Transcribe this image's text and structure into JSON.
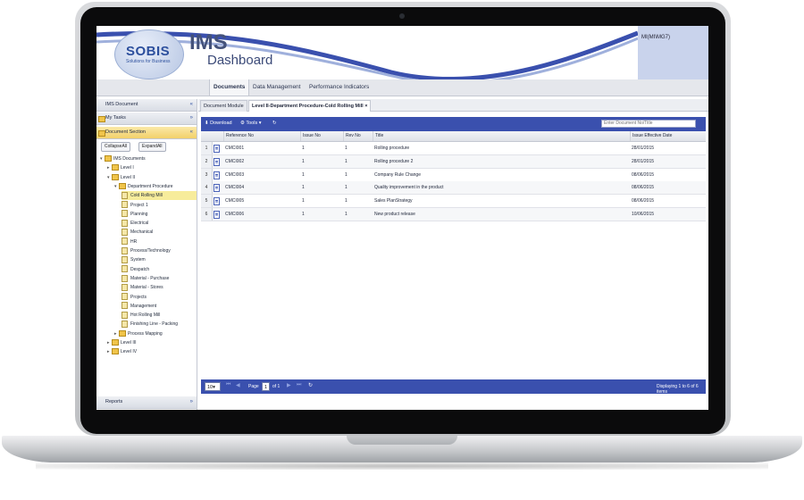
{
  "header": {
    "logo_text": "SOBIS",
    "logo_sub": "Solutions for Business",
    "title_main": "IMS",
    "title_sub": "Dashboard",
    "user_label": "MI(MI\\MG7)"
  },
  "tabs": [
    "Documents",
    "Data Management",
    "Performance Indicators"
  ],
  "left_panel": {
    "sections": {
      "ims_document": "IMS Document",
      "my_tasks": "My Tasks",
      "document_section": "Document Section",
      "reports": "Reports"
    },
    "buttons": {
      "collapse": "CollapseAll",
      "expand": "ExpandAll"
    },
    "tree": [
      {
        "label": "IMS Documents",
        "type": "folder",
        "toggle": "▾"
      },
      {
        "label": "Level I",
        "type": "folder",
        "toggle": "▸"
      },
      {
        "label": "Level II",
        "type": "folder",
        "toggle": "▾"
      },
      {
        "label": "Department Procedure",
        "type": "folder",
        "toggle": "▾"
      },
      {
        "label": "Cold Rolling Mill",
        "type": "doc",
        "selected": true
      },
      {
        "label": "Project 1",
        "type": "doc"
      },
      {
        "label": "Planning",
        "type": "doc"
      },
      {
        "label": "Electrical",
        "type": "doc"
      },
      {
        "label": "Mechanical",
        "type": "doc"
      },
      {
        "label": "HR",
        "type": "doc"
      },
      {
        "label": "Process/Technology",
        "type": "doc"
      },
      {
        "label": "System",
        "type": "doc"
      },
      {
        "label": "Despatch",
        "type": "doc"
      },
      {
        "label": "Material - Purchase",
        "type": "doc"
      },
      {
        "label": "Material - Stores",
        "type": "doc"
      },
      {
        "label": "Projects",
        "type": "doc"
      },
      {
        "label": "Management",
        "type": "doc"
      },
      {
        "label": "Hot Rolling Mill",
        "type": "doc"
      },
      {
        "label": "Finishing Line - Packing",
        "type": "doc"
      },
      {
        "label": "Process Mapping",
        "type": "folder",
        "toggle": "▸"
      },
      {
        "label": "Level III",
        "type": "folder",
        "toggle": "▸"
      },
      {
        "label": "Level IV",
        "type": "folder",
        "toggle": "▸"
      }
    ]
  },
  "subtabs": [
    "Document Module",
    "Level II-Department Procedure-Cold Rolling Mill"
  ],
  "toolbar": {
    "download": "Download",
    "tools": "Tools",
    "search_placeholder": "Enter Document No/Title"
  },
  "grid": {
    "columns": [
      "Reference No",
      "Issue No",
      "Rev No",
      "Title",
      "Issue Effective Date"
    ],
    "rows": [
      {
        "n": "1",
        "ref": "CMCI001",
        "issue": "1",
        "rev": "1",
        "title": "Rolling procedure",
        "date": "28/01/2015"
      },
      {
        "n": "2",
        "ref": "CMCI002",
        "issue": "1",
        "rev": "1",
        "title": "Rolling procedure 2",
        "date": "28/01/2015"
      },
      {
        "n": "3",
        "ref": "CMCI003",
        "issue": "1",
        "rev": "1",
        "title": "Company Rule Change",
        "date": "08/06/2015"
      },
      {
        "n": "4",
        "ref": "CMCI004",
        "issue": "1",
        "rev": "1",
        "title": "Quality improvement in the product",
        "date": "08/06/2015"
      },
      {
        "n": "5",
        "ref": "CMCI005",
        "issue": "1",
        "rev": "1",
        "title": "Sales PlanStrategy",
        "date": "08/06/2015"
      },
      {
        "n": "6",
        "ref": "CMCI006",
        "issue": "1",
        "rev": "1",
        "title": "New product release",
        "date": "10/06/2015"
      }
    ]
  },
  "pager": {
    "page_size": "10",
    "page_label": "Page",
    "page_value": "1",
    "of_label": "of 1",
    "display_text": "Displaying 1 to 6 of 6 items"
  }
}
